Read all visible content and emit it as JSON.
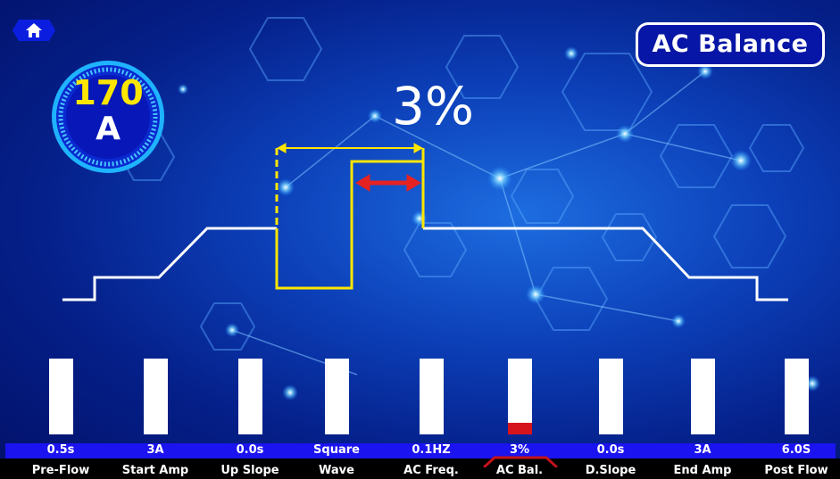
{
  "header": {
    "mode_title": "AC Balance",
    "home_icon": "home-icon"
  },
  "gauge": {
    "current_value": "170",
    "unit": "A"
  },
  "balance_readout": "3%",
  "params": [
    {
      "label": "Pre-Flow",
      "value": "0.5s"
    },
    {
      "label": "Start Amp",
      "value": "3A"
    },
    {
      "label": "Up Slope",
      "value": "0.0s"
    },
    {
      "label": "Wave",
      "value": "Square"
    },
    {
      "label": "AC Freq.",
      "value": "0.1HZ"
    },
    {
      "label": "AC Bal.",
      "value": "3%",
      "selected": true
    },
    {
      "label": "D.Slope",
      "value": "0.0s"
    },
    {
      "label": "End Amp",
      "value": "3A"
    },
    {
      "label": "Post Flow",
      "value": "6.0S"
    }
  ],
  "selected_param_level": 0.15,
  "colors": {
    "accent_yellow": "#ffe600",
    "indicator_red": "#d6141d",
    "value_strip": "#1b13f0",
    "title_bg": "#0716a6"
  }
}
